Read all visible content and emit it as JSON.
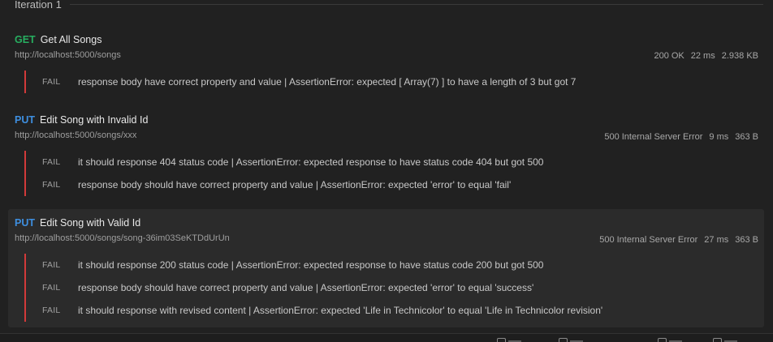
{
  "iteration": {
    "title": "Iteration 1"
  },
  "requests": [
    {
      "method": "GET",
      "name": "Get All Songs",
      "url": "http://localhost:5000/songs",
      "status": "200 OK",
      "time": "22 ms",
      "size": "2.938 KB",
      "tests": [
        {
          "status": "FAIL",
          "message": "response body have correct property and value | AssertionError: expected [ Array(7) ] to have a length of 3 but got 7"
        }
      ]
    },
    {
      "method": "PUT",
      "name": "Edit Song with Invalid Id",
      "url": "http://localhost:5000/songs/xxx",
      "status": "500 Internal Server Error",
      "time": "9 ms",
      "size": "363 B",
      "tests": [
        {
          "status": "FAIL",
          "message": "it should response 404 status code | AssertionError: expected response to have status code 404 but got 500"
        },
        {
          "status": "FAIL",
          "message": "response body should have correct property and value | AssertionError: expected 'error' to equal 'fail'"
        }
      ]
    },
    {
      "method": "PUT",
      "name": "Edit Song with Valid Id",
      "url": "http://localhost:5000/songs/song-36im03SeKTDdUrUn",
      "status": "500 Internal Server Error",
      "time": "27 ms",
      "size": "363 B",
      "tests": [
        {
          "status": "FAIL",
          "message": "it should response 200 status code | AssertionError: expected response to have status code 200 but got 500"
        },
        {
          "status": "FAIL",
          "message": "response body should have correct property and value | AssertionError: expected 'error' to equal 'success'"
        },
        {
          "status": "FAIL",
          "message": "it should response with revised content | AssertionError: expected 'Life in Technicolor' to equal 'Life in Technicolor revision'"
        }
      ]
    }
  ],
  "colors": {
    "get": "#27ae60",
    "put": "#3e8fe0",
    "fail_bar": "#d23a3a"
  }
}
